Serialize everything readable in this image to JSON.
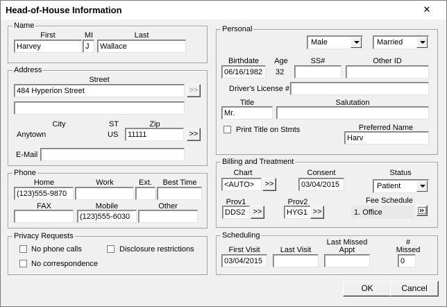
{
  "window": {
    "title": "Head-of-House Information",
    "close_glyph": "✕"
  },
  "name_group": {
    "label": "Name",
    "first_label": "First",
    "mi_label": "MI",
    "last_label": "Last",
    "first": "Harvey",
    "mi": "J",
    "last": "Wallace"
  },
  "address": {
    "label": "Address",
    "street_label": "Street",
    "street": "484 Hyperion Street",
    "street2": "",
    "street_btn": ">>",
    "city_label": "City",
    "st_label": "ST",
    "zip_label": "Zip",
    "city": "Anytown",
    "st": "US",
    "zip": "11111",
    "zip_btn": ">>",
    "email_label": "E-Mail",
    "email": ""
  },
  "phone": {
    "label": "Phone",
    "home_label": "Home",
    "work_label": "Work",
    "ext_label": "Ext.",
    "best_label": "Best Time",
    "home": "(123)555-9870",
    "work": "",
    "ext": "",
    "best": "",
    "fax_label": "FAX",
    "mobile_label": "Mobile",
    "other_label": "Other",
    "fax": "",
    "mobile": "(123)555-6030",
    "other": ""
  },
  "privacy": {
    "label": "Privacy Requests",
    "no_phone": "No phone calls",
    "disclosure": "Disclosure restrictions",
    "no_corr": "No correspondence"
  },
  "personal": {
    "label": "Personal",
    "gender": "Male",
    "marital": "Married",
    "birthdate_label": "Birthdate",
    "age_label": "Age",
    "ssn_label": "SS#",
    "otherid_label": "Other ID",
    "birthdate": "06/16/1982",
    "age": "32",
    "ssn": "",
    "otherid": "",
    "dl_label": "Driver's License #",
    "dl": "",
    "title_label": "Title",
    "salutation_label": "Salutation",
    "title": "Mr.",
    "salutation": "",
    "print_title": "Print Title on Stmts",
    "preferred_label": "Preferred Name",
    "preferred": "Harv"
  },
  "billing": {
    "label": "Billing and Treatment",
    "chart_label": "Chart",
    "chart": "<AUTO>",
    "chart_btn": ">>",
    "consent_label": "Consent",
    "consent": "03/04/2015",
    "status_label": "Status",
    "status": "Patient",
    "prov1_label": "Prov1",
    "prov1": "DDS2",
    "prov1_btn": ">>",
    "prov2_label": "Prov2",
    "prov2": "HYG1",
    "prov2_btn": ">>",
    "fee_label": "Fee Schedule",
    "fee": "1.  Office"
  },
  "scheduling": {
    "label": "Scheduling",
    "first_visit_label": "First Visit",
    "last_visit_label": "Last Visit",
    "last_missed_label1": "Last Missed",
    "last_missed_label2": "Appt",
    "missed_label1": "#",
    "missed_label2": "Missed",
    "first_visit": "03/04/2015",
    "last_visit": "",
    "last_missed": "",
    "missed": "0"
  },
  "buttons": {
    "ok": "OK",
    "cancel": "Cancel"
  }
}
